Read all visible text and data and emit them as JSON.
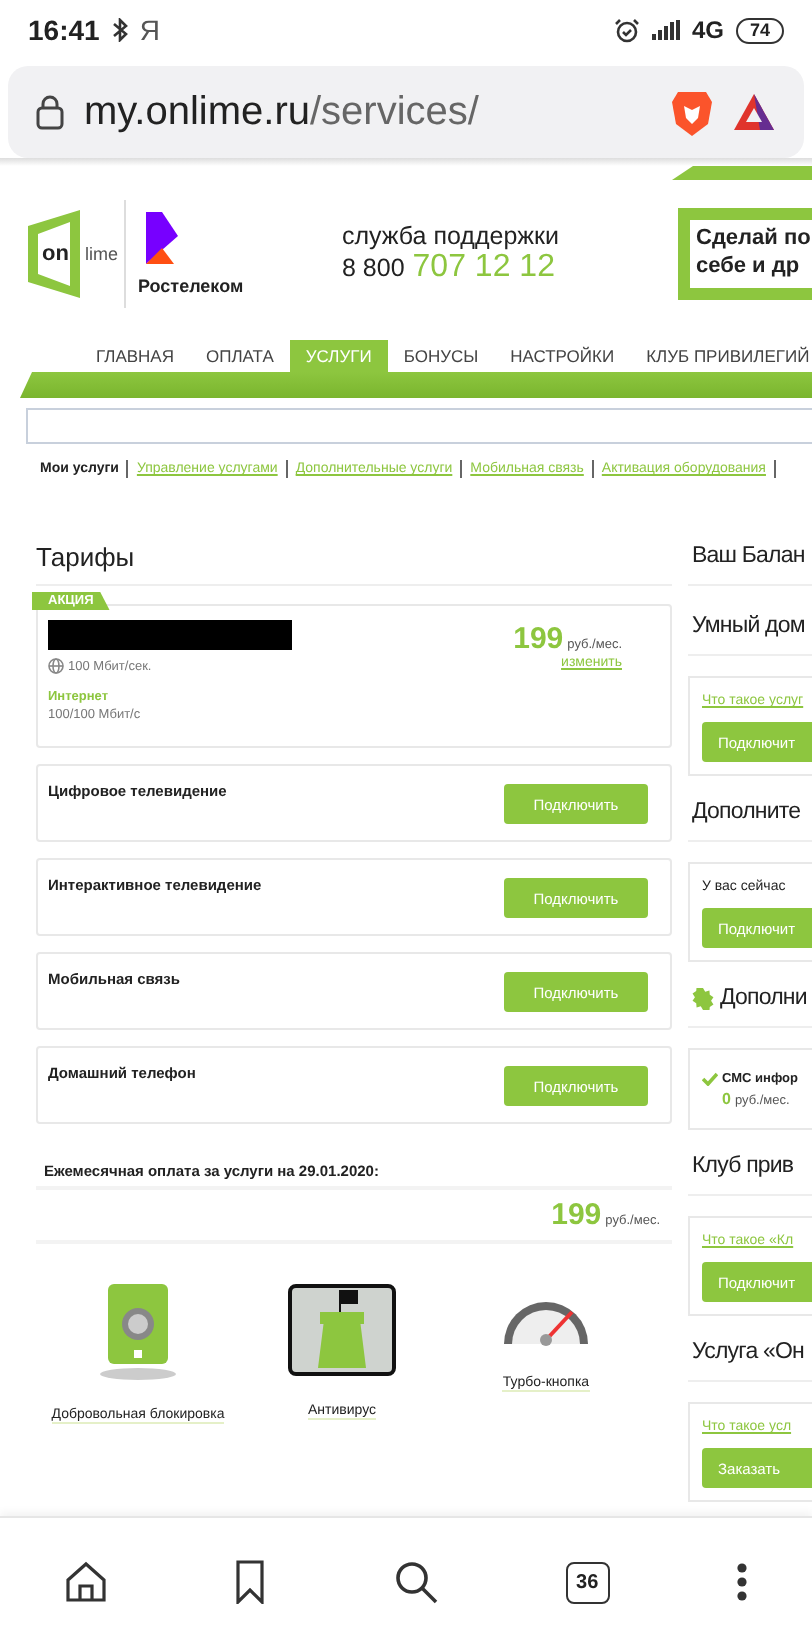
{
  "status_bar": {
    "time": "16:41",
    "carrier_glyph": "Я",
    "network": "4G",
    "battery": "74"
  },
  "address_bar": {
    "host": "my.onlime.ru",
    "path": "/services/"
  },
  "header": {
    "logo_text_1": "on",
    "logo_text_2": "lime",
    "partner": "Ростелеком",
    "support_label": "служба поддержки",
    "phone_prefix": "8 800",
    "phone_number": "707 12 12",
    "banner_lines": [
      "Сделай по",
      "себе и др"
    ]
  },
  "nav": [
    {
      "label": "ГЛАВНАЯ",
      "selected": false
    },
    {
      "label": "ОПЛАТА",
      "selected": false
    },
    {
      "label": "УСЛУГИ",
      "selected": true
    },
    {
      "label": "БОНУСЫ",
      "selected": false
    },
    {
      "label": "НАСТРОЙКИ",
      "selected": false
    },
    {
      "label": "КЛУБ ПРИВИЛЕГИЙ",
      "selected": false
    }
  ],
  "submenu": [
    {
      "label": "Мои услуги",
      "selected": true
    },
    {
      "label": "Управление услугами",
      "selected": false
    },
    {
      "label": "Дополнительные услуги",
      "selected": false
    },
    {
      "label": "Мобильная связь",
      "selected": false
    },
    {
      "label": "Активация оборудования",
      "selected": false
    }
  ],
  "tariffs": {
    "title": "Тарифы",
    "badge": "АКЦИЯ",
    "speed": "100 Мбит/сек.",
    "service": "Интернет",
    "service_speed": "100/100 Мбит/с",
    "price": "199",
    "unit": "руб./мес.",
    "change_link": "изменить"
  },
  "services": [
    {
      "name": "Цифровое телевидение",
      "button": "Подключить"
    },
    {
      "name": "Интерактивное телевидение",
      "button": "Подключить"
    },
    {
      "name": "Мобильная связь",
      "button": "Подключить"
    },
    {
      "name": "Домашний телефон",
      "button": "Подключить"
    }
  ],
  "monthly": {
    "label": "Ежемесячная оплата за услуги на 29.01.2020:",
    "price": "199",
    "unit": "руб./мес."
  },
  "extras": [
    {
      "kind": "lock",
      "label": "Добровольная блокировка"
    },
    {
      "kind": "antivirus",
      "label": "Антивирус"
    },
    {
      "kind": "speed",
      "label": "Турбо-кнопка"
    }
  ],
  "sidebar": [
    {
      "kind": "heading",
      "text": "Ваш Балан"
    },
    {
      "kind": "heading",
      "text": "Умный дом"
    },
    {
      "kind": "card",
      "link": "Что такое услуг",
      "button": "Подключит"
    },
    {
      "kind": "heading",
      "text": "Дополните"
    },
    {
      "kind": "card",
      "note": "У вас сейчас",
      "button": "Подключит"
    },
    {
      "kind": "gear-heading",
      "text": "Дополни"
    },
    {
      "kind": "check-card",
      "text": "СМС инфор",
      "price": "0",
      "unit": "руб./мес."
    },
    {
      "kind": "heading",
      "text": "Клуб прив"
    },
    {
      "kind": "card",
      "link": "Что такое «Кл",
      "button": "Подключит"
    },
    {
      "kind": "heading",
      "text": "Услуга «Он"
    },
    {
      "kind": "card",
      "link": "Что такое усл",
      "button": "Заказать"
    }
  ],
  "bottom_bar": {
    "tabs_count": "36"
  }
}
